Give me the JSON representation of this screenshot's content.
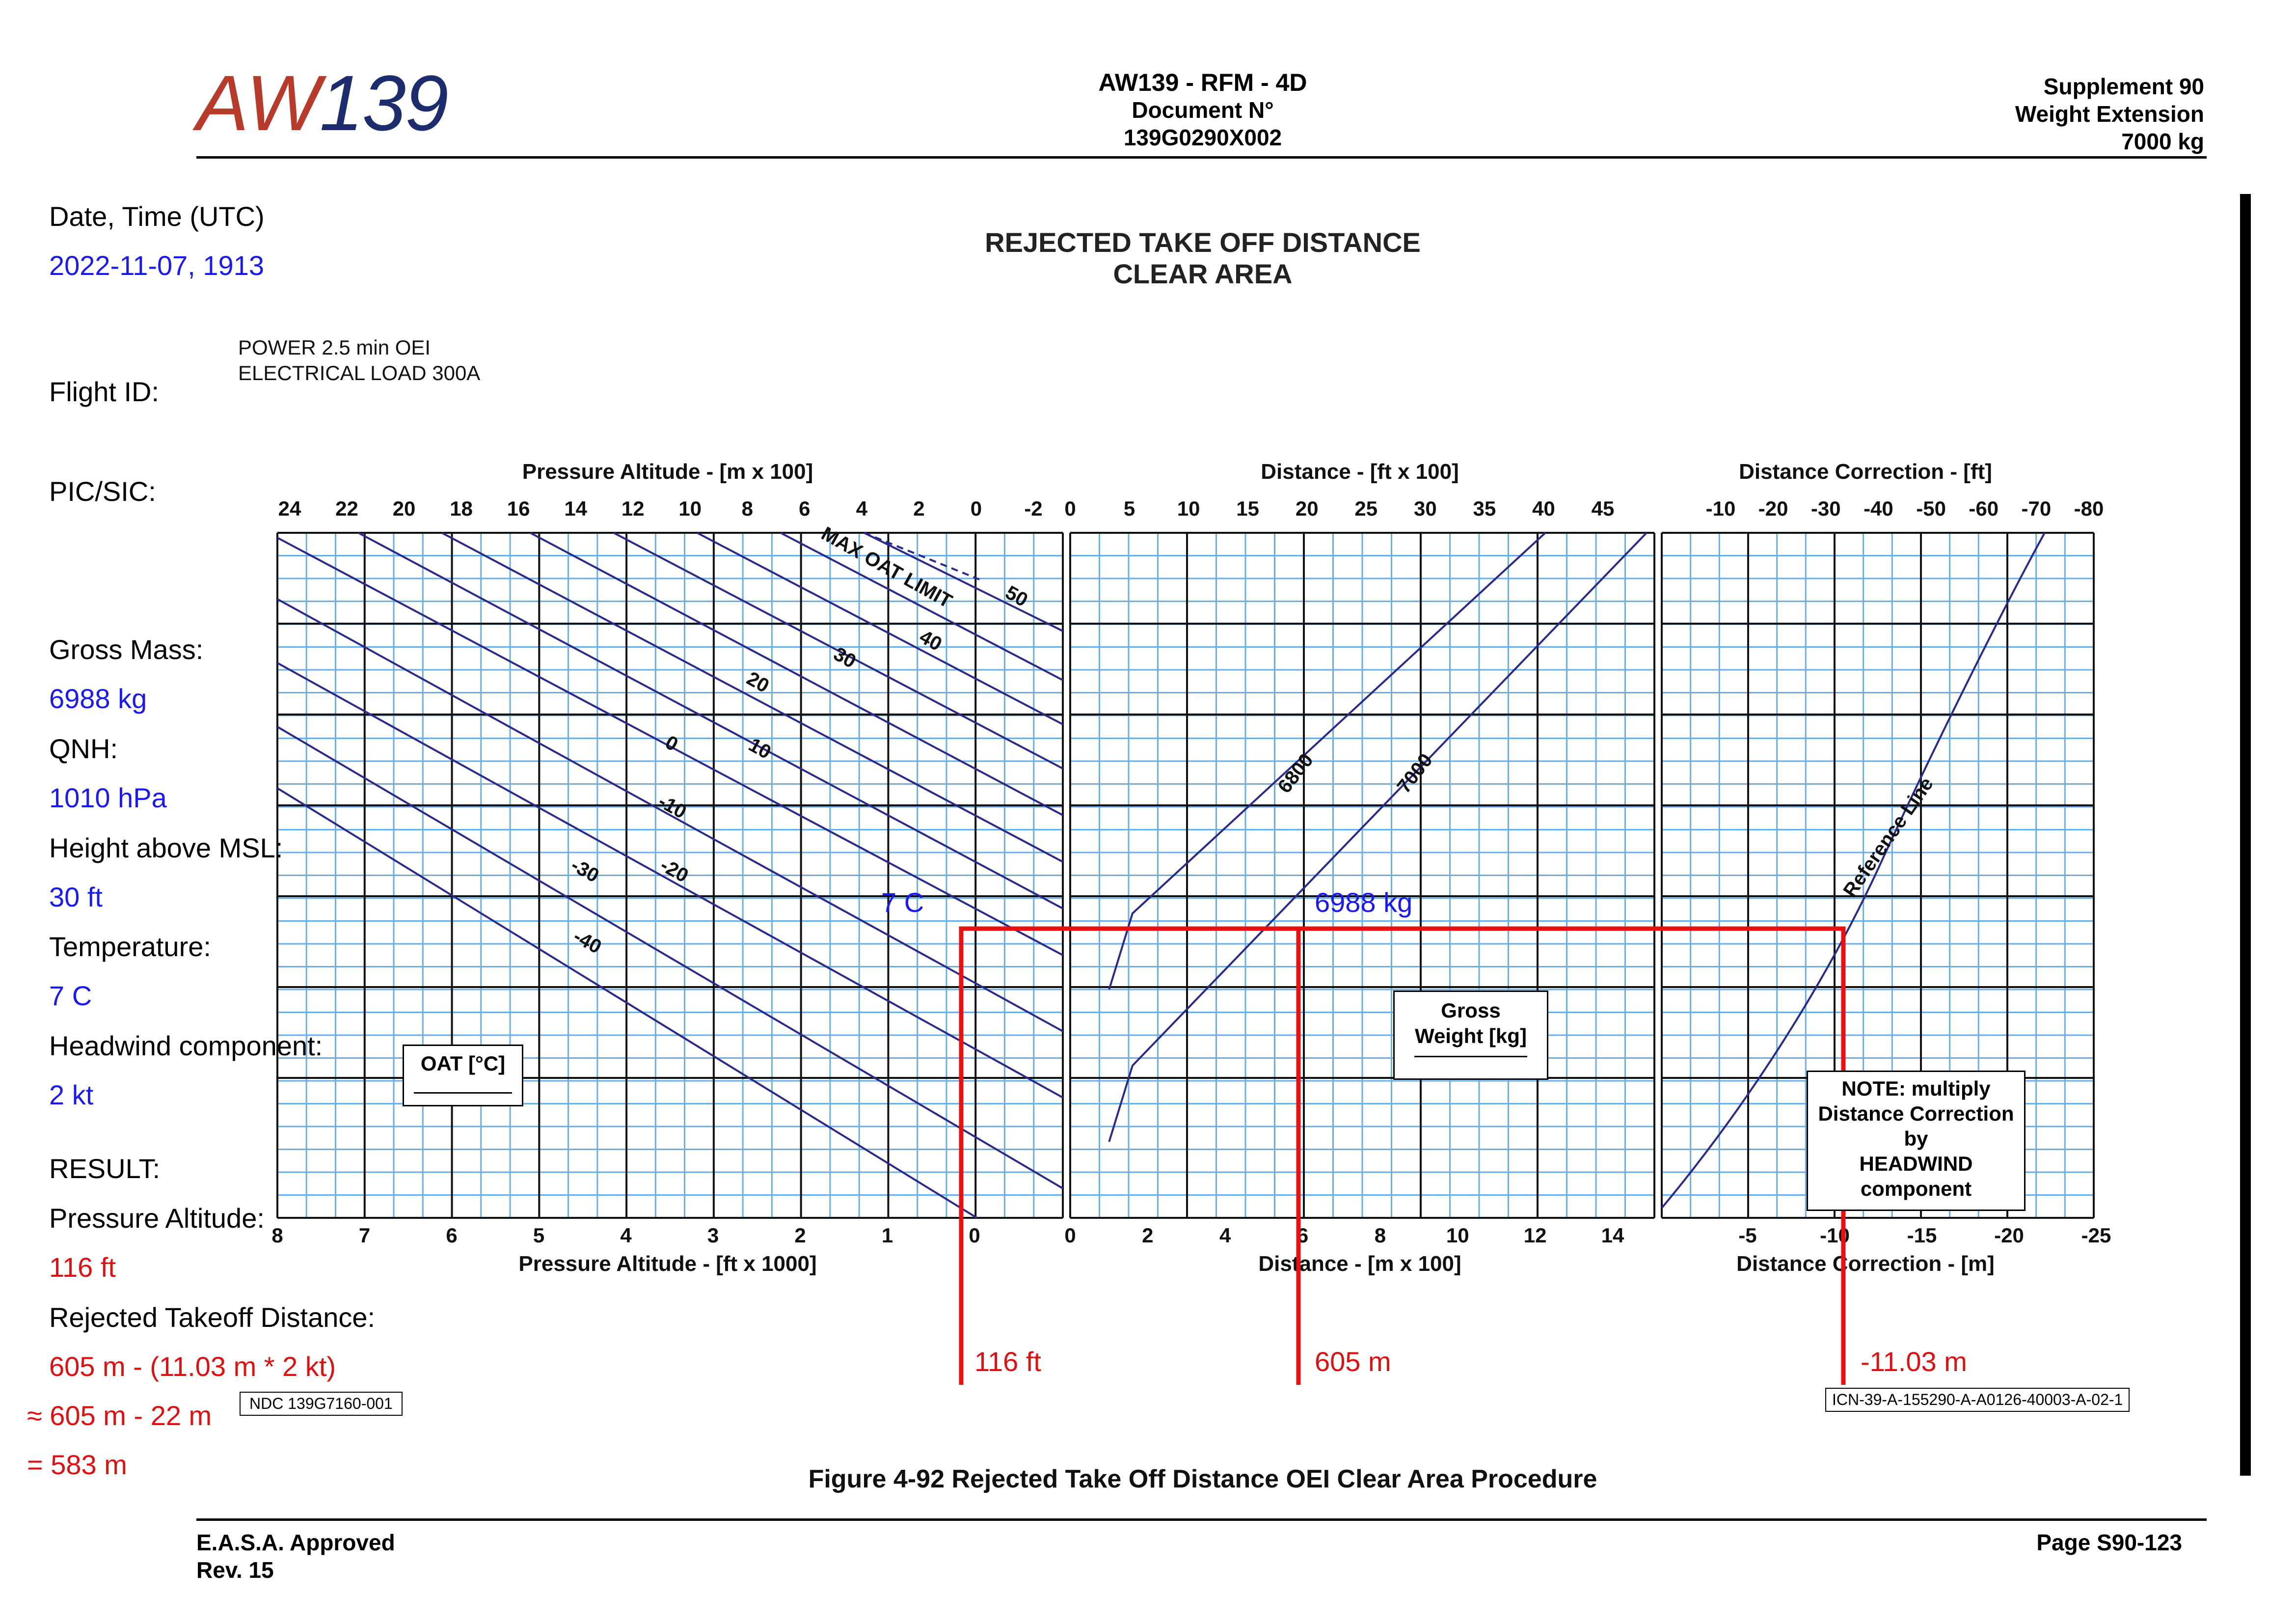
{
  "header": {
    "logo_left": "AW",
    "logo_right": "139",
    "doc_title": "AW139 - RFM - 4D",
    "doc_label": "Document N°",
    "doc_number": "139G0290X002",
    "supp_title": "Supplement 90",
    "supp_sub": "Weight Extension",
    "supp_mass": "7000 kg"
  },
  "notes": {
    "date_label": "Date, Time (UTC)",
    "date_value": "2022-11-07, 1913",
    "flight_label": "Flight ID:",
    "pic_label": "PIC/SIC:",
    "gross_label": "Gross Mass:",
    "gross_value": "6988 kg",
    "qnh_label": "QNH:",
    "qnh_value": "1010 hPa",
    "height_label": "Height above MSL:",
    "height_value": "30 ft",
    "temp_label": "Temperature:",
    "temp_value": "7 C",
    "wind_label": "Headwind component:",
    "wind_value": "2 kt",
    "result_label": "RESULT:",
    "pa_label": "Pressure Altitude:",
    "pa_value": "116 ft",
    "rto_label": "Rejected Takeoff Distance:",
    "rto_line1": "605 m - (11.03 m * 2 kt)",
    "rto_line2": "≈ 605 m - 22 m",
    "rto_line3": "= 583 m"
  },
  "chart_data": {
    "type": "line",
    "title": "REJECTED TAKE OFF DISTANCE",
    "subtitle": "CLEAR AREA",
    "conditions": [
      "POWER 2.5 min OEI",
      "ELECTRICAL LOAD 300A"
    ],
    "panels": [
      {
        "name": "altitude",
        "top_axis_label": "Pressure Altitude - [m x 100]",
        "top_ticks": [
          "24",
          "22",
          "20",
          "18",
          "16",
          "14",
          "12",
          "10",
          "8",
          "6",
          "4",
          "2",
          "0",
          "-2"
        ],
        "bottom_axis_label": "Pressure Altitude - [ft x 1000]",
        "bottom_ticks": [
          "8",
          "7",
          "6",
          "5",
          "4",
          "3",
          "2",
          "1",
          "0"
        ],
        "xlim": [
          8,
          -1
        ],
        "legend_box": "OAT [°C]",
        "max_oat_label": "MAX OAT LIMIT",
        "oat_series": [
          {
            "name": "50",
            "oat_c": 50
          },
          {
            "name": "40",
            "oat_c": 40
          },
          {
            "name": "30",
            "oat_c": 30
          },
          {
            "name": "20",
            "oat_c": 20
          },
          {
            "name": "10",
            "oat_c": 10
          },
          {
            "name": "0",
            "oat_c": 0
          },
          {
            "name": "-10",
            "oat_c": -10
          },
          {
            "name": "-20",
            "oat_c": -20
          },
          {
            "name": "-30",
            "oat_c": -30
          },
          {
            "name": "-40",
            "oat_c": -40
          }
        ]
      },
      {
        "name": "distance",
        "top_axis_label": "Distance - [ft x 100]",
        "top_ticks": [
          "0",
          "5",
          "10",
          "15",
          "20",
          "25",
          "30",
          "35",
          "40",
          "45"
        ],
        "bottom_axis_label": "Distance - [m x 100]",
        "bottom_ticks": [
          "0",
          "2",
          "4",
          "6",
          "8",
          "10",
          "12",
          "14"
        ],
        "xlim": [
          0,
          15
        ],
        "legend_box": "Gross Weight [kg]",
        "weight_series": [
          {
            "name": "6800",
            "points_m100": [
              [
                1.0,
                3.0
              ],
              [
                1.6,
                4.0
              ],
              [
                12.2,
                9.0
              ]
            ]
          },
          {
            "name": "7000",
            "points_m100": [
              [
                1.0,
                1.0
              ],
              [
                1.6,
                2.0
              ],
              [
                14.8,
                9.0
              ]
            ]
          }
        ]
      },
      {
        "name": "correction",
        "top_axis_label": "Distance Correction - [ft]",
        "top_ticks": [
          "-10",
          "-20",
          "-30",
          "-40",
          "-50",
          "-60",
          "-70",
          "-80"
        ],
        "bottom_axis_label": "Distance Correction - [m]",
        "bottom_ticks": [
          "-5",
          "-10",
          "-15",
          "-20",
          "-25"
        ],
        "xlim": [
          0,
          -25
        ],
        "reference_line_label": "Reference Line",
        "note_box": [
          "NOTE: multiply",
          "Distance Correction",
          "by",
          "HEADWIND",
          "component"
        ]
      }
    ],
    "annotations": {
      "oat_input": "7 C",
      "weight_input": "6988 kg",
      "pa_result": "116 ft",
      "distance_result": "605 m",
      "correction_result": "-11.03 m"
    }
  },
  "footer": {
    "ndc": "NDC 139G7160-001",
    "icn": "ICN-39-A-155290-A-A0126-40003-A-02-1",
    "figure_caption": "Figure 4-92  Rejected Take Off Distance OEI Clear Area Procedure",
    "approved": "E.A.S.A. Approved",
    "rev": "Rev. 15",
    "page": "Page S90-123"
  }
}
